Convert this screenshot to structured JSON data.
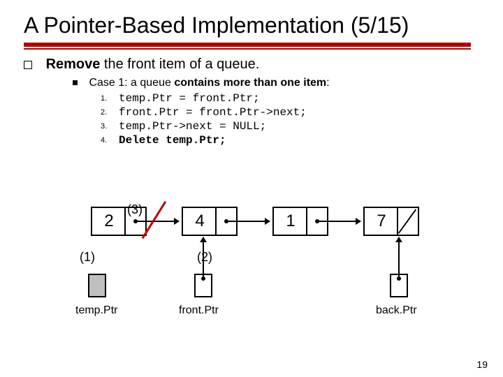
{
  "title": "A Pointer-Based Implementation (5/15)",
  "bullet1": {
    "bold": "Remove",
    "rest": " the front item of a queue."
  },
  "bullet2": {
    "pre": "Case 1: a queue ",
    "bold": "contains more than one item",
    "post": ":"
  },
  "steps": [
    "temp.Ptr = front.Ptr;",
    "front.Ptr = front.Ptr->next;",
    "temp.Ptr->next = NULL;",
    "Delete temp.Ptr;"
  ],
  "step_nums": [
    "1.",
    "2.",
    "3.",
    "4."
  ],
  "nodes": [
    "2",
    "4",
    "1",
    "7"
  ],
  "ann": {
    "a3": "(3)",
    "a1": "(1)",
    "a2": "(2)"
  },
  "ptr_labels": {
    "temp": "temp.Ptr",
    "front": "front.Ptr",
    "back": "back.Ptr"
  },
  "page_number": "19"
}
